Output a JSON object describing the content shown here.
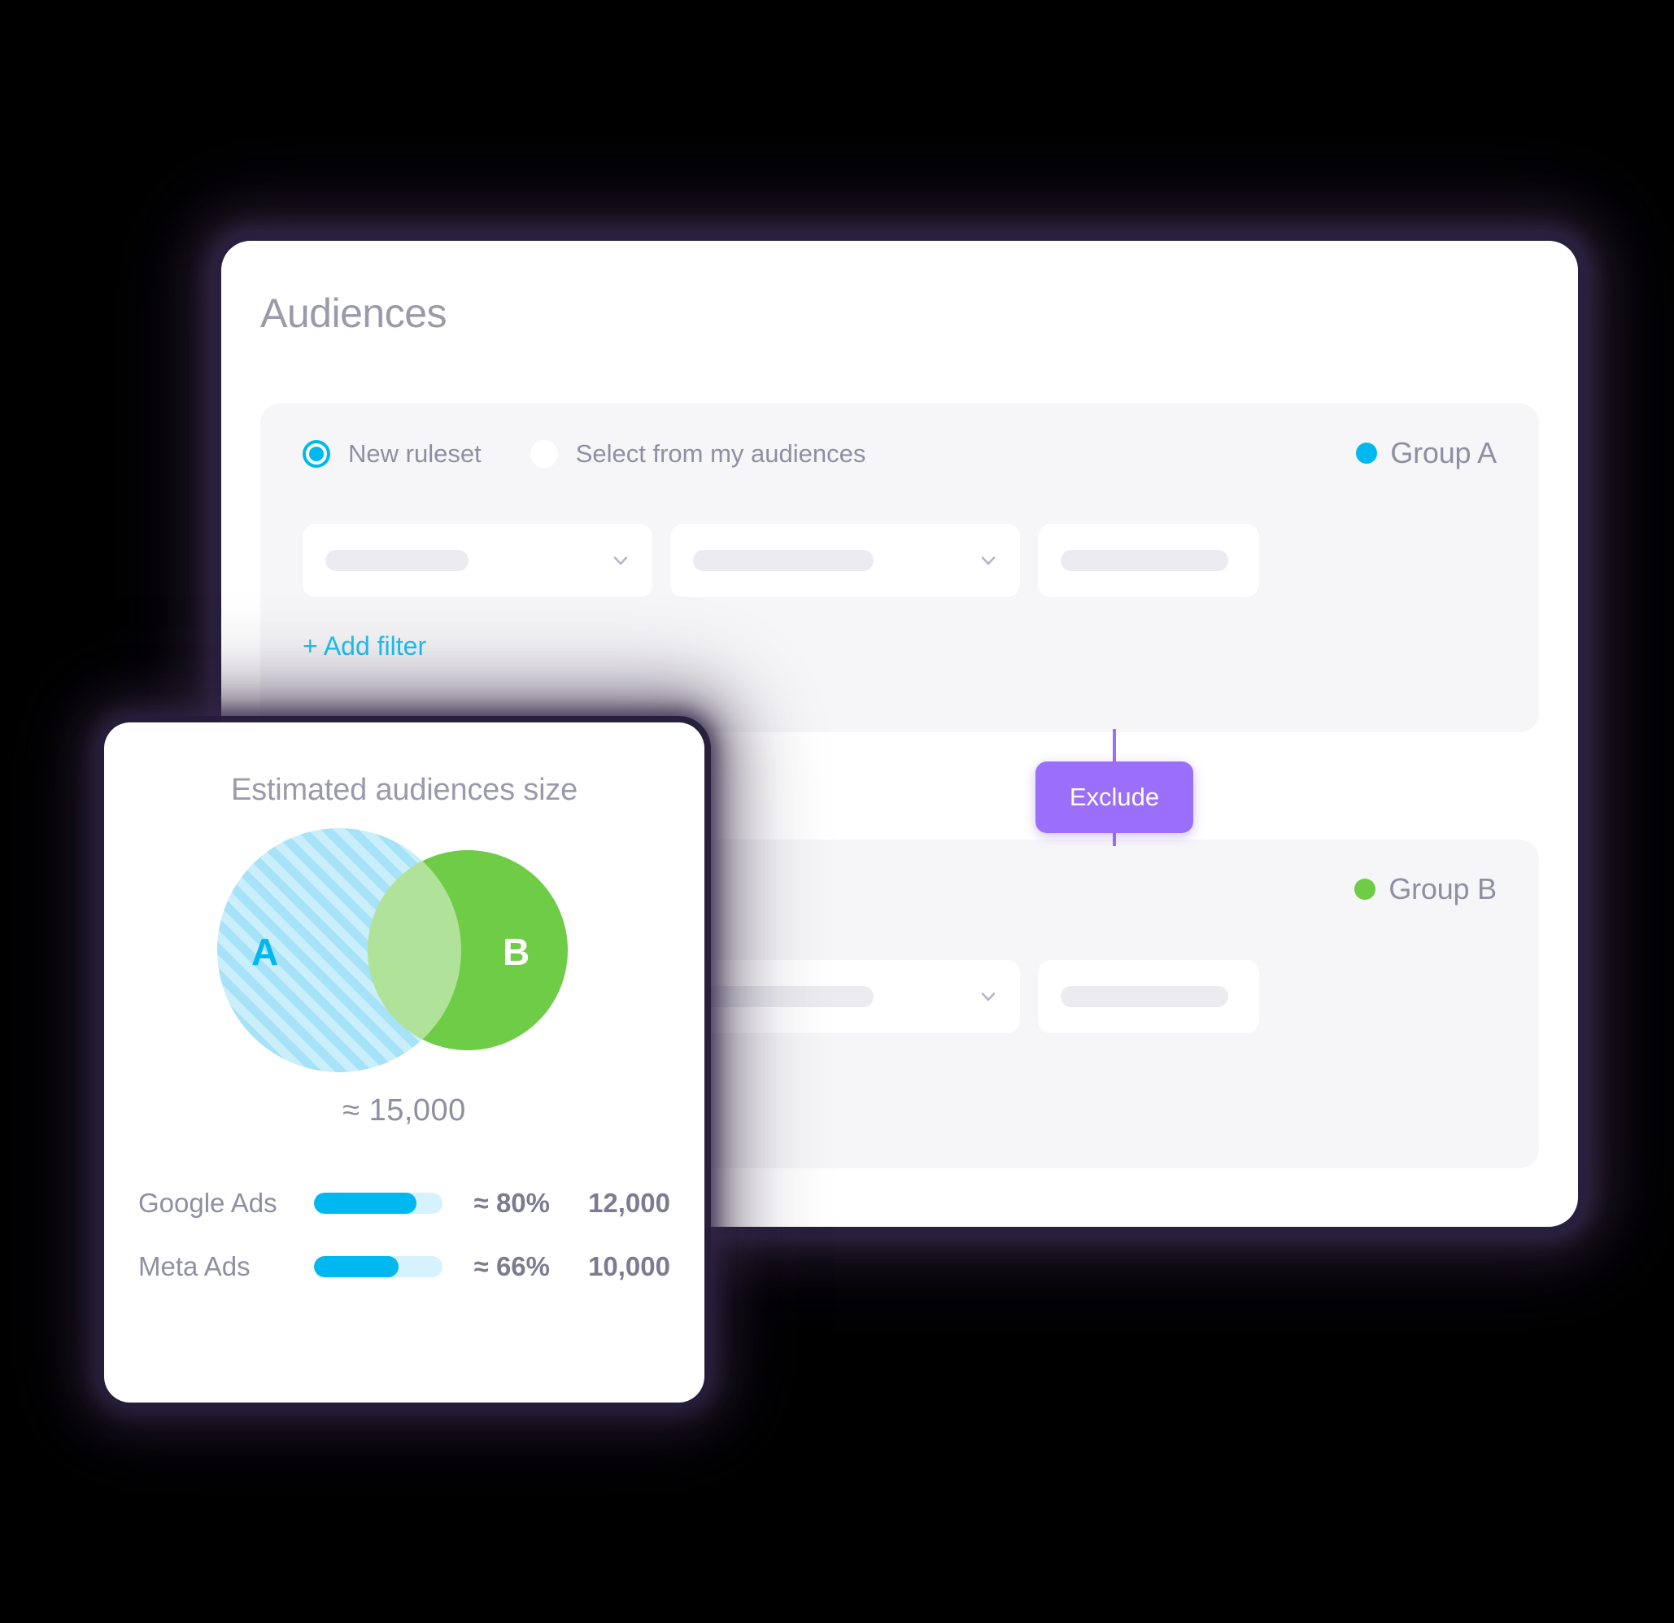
{
  "page": {
    "title": "Audiences"
  },
  "colors": {
    "accent_cyan": "#00B8F0",
    "link_cyan": "#1FC3F7",
    "group_a": "#00B8F0",
    "group_b": "#6FCC46",
    "exclude_purple": "#9B6FFA",
    "text_muted": "#8f8fa3",
    "panel_bg": "#f6f6f8"
  },
  "groups": [
    {
      "id": "group-a",
      "name": "Group A",
      "dot_color": "#00B8F0",
      "mode_options": [
        {
          "label": "New ruleset",
          "selected": true
        },
        {
          "label": "Select from my audiences",
          "selected": false
        }
      ],
      "show_mode_options": true,
      "fields": [
        {
          "type": "select",
          "value": "",
          "has_chevron": true,
          "skeleton": "s1"
        },
        {
          "type": "select",
          "value": "",
          "has_chevron": true,
          "skeleton": "s2"
        },
        {
          "type": "text",
          "value": "",
          "has_chevron": false,
          "skeleton": "s3"
        }
      ],
      "add_filter_label": "+ Add filter",
      "show_add_filter": true
    },
    {
      "id": "group-b",
      "name": "Group B",
      "dot_color": "#6FCC46",
      "mode_options": [],
      "show_mode_options": false,
      "fields": [
        {
          "type": "select",
          "value": "",
          "has_chevron": true,
          "skeleton": "s1"
        },
        {
          "type": "select",
          "value": "",
          "has_chevron": true,
          "skeleton": "s2"
        },
        {
          "type": "text",
          "value": "",
          "has_chevron": false,
          "skeleton": "s3"
        }
      ],
      "add_filter_label": "+ Add filter",
      "show_add_filter": false
    }
  ],
  "exclude": {
    "label": "Exclude"
  },
  "estimate": {
    "title": "Estimated audiences size",
    "total_label": "≈ 15,000",
    "venn": {
      "circle_a_label": "A",
      "circle_b_label": "B",
      "circle_a_fill": "#CBEEFB",
      "circle_a_stripe": "#A6E2F8",
      "circle_b_fill": "#6FCC46",
      "a_label_color": "#00B8F0",
      "b_label_color": "#ffffff"
    },
    "platforms": [
      {
        "name": "Google Ads",
        "percent_label": "≈ 80%",
        "percent_value": 80,
        "count_label": "12,000"
      },
      {
        "name": "Meta Ads",
        "percent_label": "≈ 66%",
        "percent_value": 66,
        "count_label": "10,000"
      }
    ]
  }
}
